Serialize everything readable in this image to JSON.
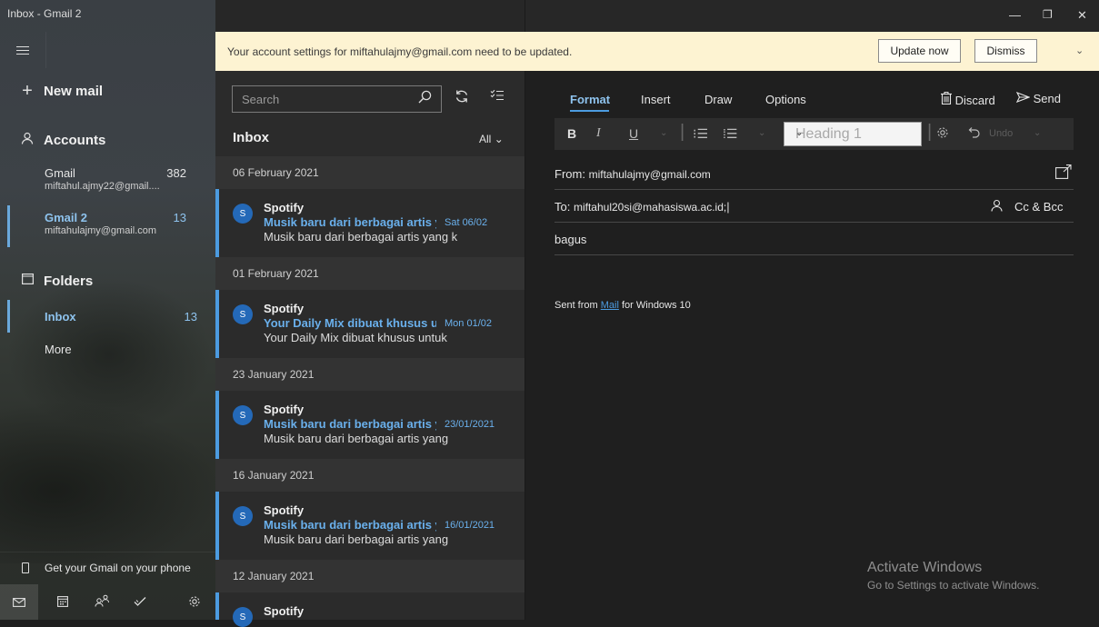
{
  "window": {
    "title": "Inbox - Gmail 2",
    "controls": [
      "—",
      "❐",
      "✕"
    ]
  },
  "sidebar": {
    "new_mail": "New mail",
    "accounts_label": "Accounts",
    "accounts": [
      {
        "name": "Gmail",
        "email": "miftahul.ajmy22@gmail....",
        "count": "382"
      },
      {
        "name": "Gmail 2",
        "email": "miftahulajmy@gmail.com",
        "count": "13"
      }
    ],
    "folders_label": "Folders",
    "folders": [
      {
        "name": "Inbox",
        "count": "13"
      },
      {
        "name": "More",
        "count": ""
      }
    ],
    "phone_prompt": "Get your Gmail on your phone"
  },
  "banner": {
    "message": "Your account settings for miftahulajmy@gmail.com need to be updated.",
    "update_label": "Update now",
    "dismiss_label": "Dismiss"
  },
  "message_list": {
    "search_placeholder": "Search",
    "folder_title": "Inbox",
    "filter_label": "All",
    "groups": [
      {
        "date": "06 February 2021",
        "from": "Spotify",
        "avatar": "S",
        "subject": "Musik baru dari berbagai artis yang",
        "date_short": "Sat 06/02",
        "preview": "Musik baru dari berbagai artis yang k"
      },
      {
        "date": "01 February 2021",
        "from": "Spotify",
        "avatar": "S",
        "subject": "Your Daily Mix dibuat khusus untu",
        "date_short": "Mon 01/02",
        "preview": "Your Daily Mix dibuat khusus untuk"
      },
      {
        "date": "23 January 2021",
        "from": "Spotify",
        "avatar": "S",
        "subject": "Musik baru dari berbagai artis yan",
        "date_short": "23/01/2021",
        "preview": "Musik baru dari berbagai artis yang"
      },
      {
        "date": "16 January 2021",
        "from": "Spotify",
        "avatar": "S",
        "subject": "Musik baru dari berbagai artis yan",
        "date_short": "16/01/2021",
        "preview": "Musik baru dari berbagai artis yang"
      },
      {
        "date": "12 January 2021",
        "from": "Spotify",
        "avatar": "S"
      }
    ]
  },
  "compose": {
    "tabs": [
      "Format",
      "Insert",
      "Draw",
      "Options"
    ],
    "active_tab": "Format",
    "discard_label": "Discard",
    "send_label": "Send",
    "heading_value": "Heading 1",
    "undo_label": "Undo",
    "from_label": "From:",
    "from_value": "miftahulajmy@gmail.com",
    "to_label": "To:",
    "to_value": "miftahul20si@mahasiswa.ac.id;",
    "ccbcc_label": "Cc & Bcc",
    "subject_value": "bagus",
    "signature_prefix": "Sent from ",
    "signature_link": "Mail",
    "signature_suffix": " for Windows 10"
  },
  "watermark": {
    "line1": "Activate Windows",
    "line2": "Go to Settings to activate Windows."
  },
  "colors": {
    "accent": "#4c9be0",
    "banner": "#fdf3d2",
    "avatar": "#2469b8"
  }
}
